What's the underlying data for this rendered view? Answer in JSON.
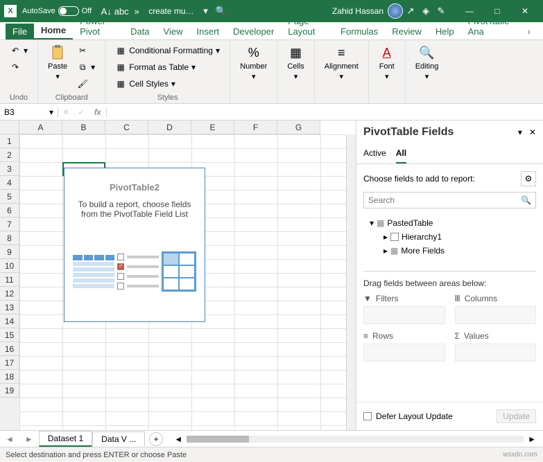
{
  "titlebar": {
    "autosave_label": "AutoSave",
    "autosave_state": "Off",
    "doc_name": "create mu…",
    "user_name": "Zahid Hassan"
  },
  "tabs": [
    "File",
    "Home",
    "Power Pivot",
    "Data",
    "View",
    "Insert",
    "Developer",
    "Page Layout",
    "Formulas",
    "Review",
    "Help",
    "PivotTable Ana"
  ],
  "active_tab": "Home",
  "ribbon": {
    "undo": "Undo",
    "clipboard": "Clipboard",
    "paste": "Paste",
    "styles": "Styles",
    "cond_fmt": "Conditional Formatting",
    "fmt_table": "Format as Table",
    "cell_styles": "Cell Styles",
    "number": "Number",
    "cells": "Cells",
    "alignment": "Alignment",
    "font": "Font",
    "editing": "Editing"
  },
  "namebox": "B3",
  "columns": [
    "A",
    "B",
    "C",
    "D",
    "E",
    "F",
    "G"
  ],
  "rows": [
    "1",
    "2",
    "3",
    "4",
    "5",
    "6",
    "7",
    "8",
    "9",
    "10",
    "11",
    "12",
    "13",
    "14",
    "15",
    "16",
    "17",
    "18",
    "19"
  ],
  "pvt": {
    "title": "PivotTable2",
    "desc": "To build a report, choose fields from the PivotTable Field List"
  },
  "panel": {
    "title": "PivotTable Fields",
    "tabs": [
      "Active",
      "All"
    ],
    "active_ptab": "All",
    "choose": "Choose fields to add to report:",
    "search": "Search",
    "tree": {
      "table": "PastedTable",
      "hierarchy": "Hierarchy1",
      "more": "More Fields"
    },
    "areas_title": "Drag fields between areas below:",
    "filters": "Filters",
    "cols": "Columns",
    "rows": "Rows",
    "values": "Values",
    "defer": "Defer Layout Update",
    "update": "Update"
  },
  "sheets": [
    "Dataset 1",
    "Data V ..."
  ],
  "status_text": "Select destination and press ENTER or choose Paste",
  "watermark": "wsxdn.com"
}
